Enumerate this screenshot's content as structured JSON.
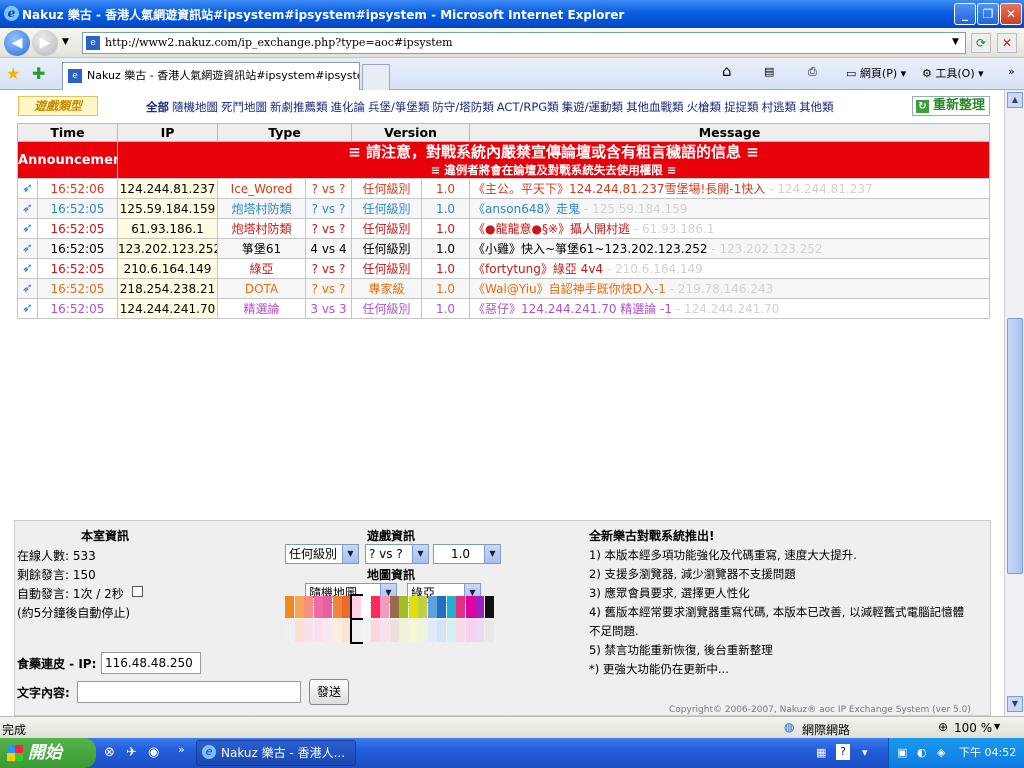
{
  "window": {
    "title": "Nakuz 樂古 - 香港人氣網遊資訊站#ipsystem#ipsystem#ipsystem - Microsoft Internet Explorer",
    "minimize": "_",
    "maximize": "❐",
    "close": "✕"
  },
  "browser": {
    "url": "http://www2.nakuz.com/ip_exchange.php?type=aoc#ipsystem",
    "tab_title": "Nakuz 樂古 - 香港人氣網遊資訊站#ipsystem#ipsyste...",
    "home_label": "網頁(P)",
    "tools_label": "工具(O)",
    "back_icon": "back-arrow-icon",
    "forward_icon": "forward-arrow-icon"
  },
  "gamebar": {
    "label": "遊戲類型",
    "categories": [
      "全部",
      "隨機地圖",
      "死鬥地圖",
      "新劇推薦類",
      "進化論",
      "兵堡/箏堡類",
      "防守/塔防類",
      "ACT/RPG類",
      "集遊/運動類",
      "其他血戰類",
      "火槍類",
      "捉捉類",
      "村逃類",
      "其他類"
    ],
    "refresh": "重新整理"
  },
  "table": {
    "headers": [
      "Time",
      "IP",
      "Type",
      "Version",
      "Message"
    ],
    "announcement_label": "Announcement",
    "announcement_line1": "≡ 請注意，對戰系統內嚴禁宣傳論壇或含有粗言穢語的信息 ≡",
    "announcement_line2": "≡ 違例者將會在論壇及對戰系統失去使用權限 ≡",
    "rows": [
      {
        "time": "16:52:06",
        "ip": "124.244.81.237",
        "type": "Ice_Wored",
        "vs": "? vs ?",
        "level": "任何級別",
        "ver": "1.0",
        "msg": "《主公。平天下》124.244.81.237雪堡場!長開-1快入",
        "ghost": "- 124.244.81.237",
        "color": "#d43a1a",
        "bg": "#fff"
      },
      {
        "time": "16:52:05",
        "ip": "125.59.184.159",
        "type": "炮塔村防類",
        "vs": "? vs ?",
        "level": "任何級別",
        "ver": "1.0",
        "msg": "《anson648》走鬼",
        "ghost": "- 125.59.184.159",
        "color": "#2a8ac8",
        "bg": "#f6f6f6"
      },
      {
        "time": "16:52:05",
        "ip": "61.93.186.1",
        "type": "炮塔村防類",
        "vs": "? vs ?",
        "level": "任何級別",
        "ver": "1.0",
        "msg": "《●龍龍意●§※》攝人開村逃",
        "ghost": "- 61.93.186.1",
        "color": "#c81818",
        "bg": "#fff"
      },
      {
        "time": "16:52:05",
        "ip": "123.202.123.252",
        "type": "箏堡61",
        "vs": "4 vs 4",
        "level": "任何級別",
        "ver": "1.0",
        "msg": "《小雞》快入~箏堡61~123.202.123.252",
        "ghost": "- 123.202.123.252",
        "color": "#000000",
        "bg": "#f6f6f6"
      },
      {
        "time": "16:52:05",
        "ip": "210.6.164.149",
        "type": "綠亞",
        "vs": "? vs ?",
        "level": "任何級別",
        "ver": "1.0",
        "msg": "《fortytung》綠亞 4v4",
        "ghost": "- 210.6.164.149",
        "color": "#c81818",
        "bg": "#fff"
      },
      {
        "time": "16:52:05",
        "ip": "218.254.238.21",
        "type": "DOTA",
        "vs": "? vs ?",
        "level": "專家級",
        "ver": "1.0",
        "msg": "《Wal@Yiu》自認神手既你快D入-1",
        "ghost": "- 219.78.146.243",
        "color": "#e07010",
        "bg": "#f6f6f6"
      },
      {
        "time": "16:52:05",
        "ip": "124.244.241.70",
        "type": "精選論",
        "vs": "3 vs 3",
        "level": "任何級別",
        "ver": "1.0",
        "msg": "《惡仔》124.244.241.70 精選論 -1",
        "ghost": "- 124.244.241.70",
        "color": "#b050c8",
        "bg": "#fff"
      }
    ]
  },
  "room": {
    "title": "本室資訊",
    "online": "在線人數: 533",
    "remain": "剩餘發言: 150",
    "auto": "自動發言: 1次 / 2秒",
    "auto_note": "(約5分鐘後自動停止)",
    "ip_label": "食藥連皮 - IP:",
    "ip_value": "116.48.48.250",
    "text_label": "文字內容:",
    "send": "發送"
  },
  "game": {
    "title": "遊戲資訊",
    "level": "任何級別",
    "vs": "? vs ?",
    "ver": "1.0",
    "map_title": "地圖資訊",
    "map_type": "隨機地圖",
    "map_name": "綠亞",
    "palette_top": [
      "#f08a1c",
      "#f6a85a",
      "#f79080",
      "#f26aa5",
      "#e85fa0",
      "#f2853a",
      "#ef6a2a",
      "#ffd1e6",
      "#ffffff",
      "#ff2a5a",
      "#f29ac0",
      "#9a6a4a",
      "#a0c020",
      "#e0e000",
      "#c0d040",
      "#60a0e0",
      "#2070c0",
      "#20b0d0",
      "#e03080",
      "#e000a0",
      "#a020c0",
      "#101010"
    ],
    "palette_bottom": [
      "#f0f0f0",
      "#fae0d0",
      "#fae0e8",
      "#f8e0f0",
      "#f8e8f0",
      "#fcecdc",
      "#fce4d4",
      "#f0f0f0",
      "#f4f4f4",
      "#fad8dc",
      "#f8e0ec",
      "#eee0d8",
      "#eef4d4",
      "#f8f8d0",
      "#f0f4dc",
      "#dcecf8",
      "#d4e4f4",
      "#d4f0f4",
      "#f8d8e8",
      "#f8d0f0",
      "#ecd8f4",
      "#e8e8e8"
    ]
  },
  "news": {
    "title": "全新樂古對戰系統推出!",
    "items": [
      "1) 本版本經多項功能強化及代碼重寫, 速度大大提升.",
      "2) 支援多瀏覽器, 減少瀏覽器不支援問題",
      "3) 應眾會員要求, 選擇更人性化",
      "4) 舊版本經常要求瀏覽器重寫代碼, 本版本已改善, 以減輕舊式電腦記憶體",
      "不足問題.",
      "5) 禁言功能重新恢復, 後台重新整理",
      "*) 更強大功能仍在更新中..."
    ],
    "footer": "Copyright© 2006-2007, Nakuz® aoc IP Exchange System (ver 5.0)"
  },
  "status": {
    "left": "完成",
    "zone": "網際網路",
    "zoom": "100 %"
  },
  "taskbar": {
    "start": "開始",
    "task": "Nakuz 樂古 - 香港人...",
    "clock": "下午 04:52"
  }
}
